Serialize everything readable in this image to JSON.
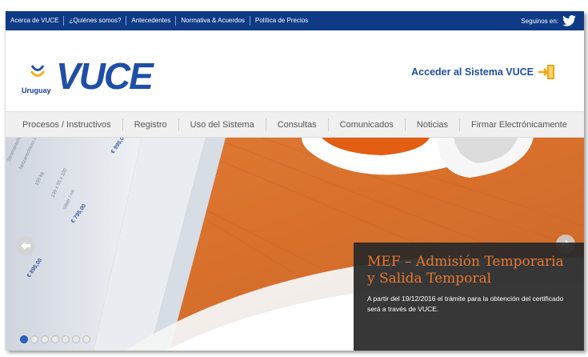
{
  "topbar": {
    "links": [
      "Acerca de VUCE",
      "¿Quiénes somos?",
      "Antecedentes",
      "Normativa & Acuerdos",
      "Política de Precios"
    ],
    "social_label": "Seguinos en:",
    "social_icon": "twitter-icon",
    "bg_color": "#0e3a86"
  },
  "header": {
    "logo_country": "Uruguay",
    "logo_brand": "VUCE",
    "access_label": "Acceder al Sistema VUCE",
    "access_icon": "login-door-icon",
    "accent_color": "#1e4ea6"
  },
  "mainnav": {
    "items": [
      "Procesos / Instructivos",
      "Registro",
      "Uso del Sistema",
      "Consultas",
      "Comunicados",
      "Noticias",
      "Firmar Electrónicamente"
    ]
  },
  "hero": {
    "caption_title": "MEF – Admisión Temporaria y Salida Temporal",
    "caption_text": "A partir del 19/12/2016 el trámite para la obtención del certificado será a través de VUCE.",
    "slide_count": 7,
    "active_slide": 1,
    "title_color": "#e8772e"
  }
}
